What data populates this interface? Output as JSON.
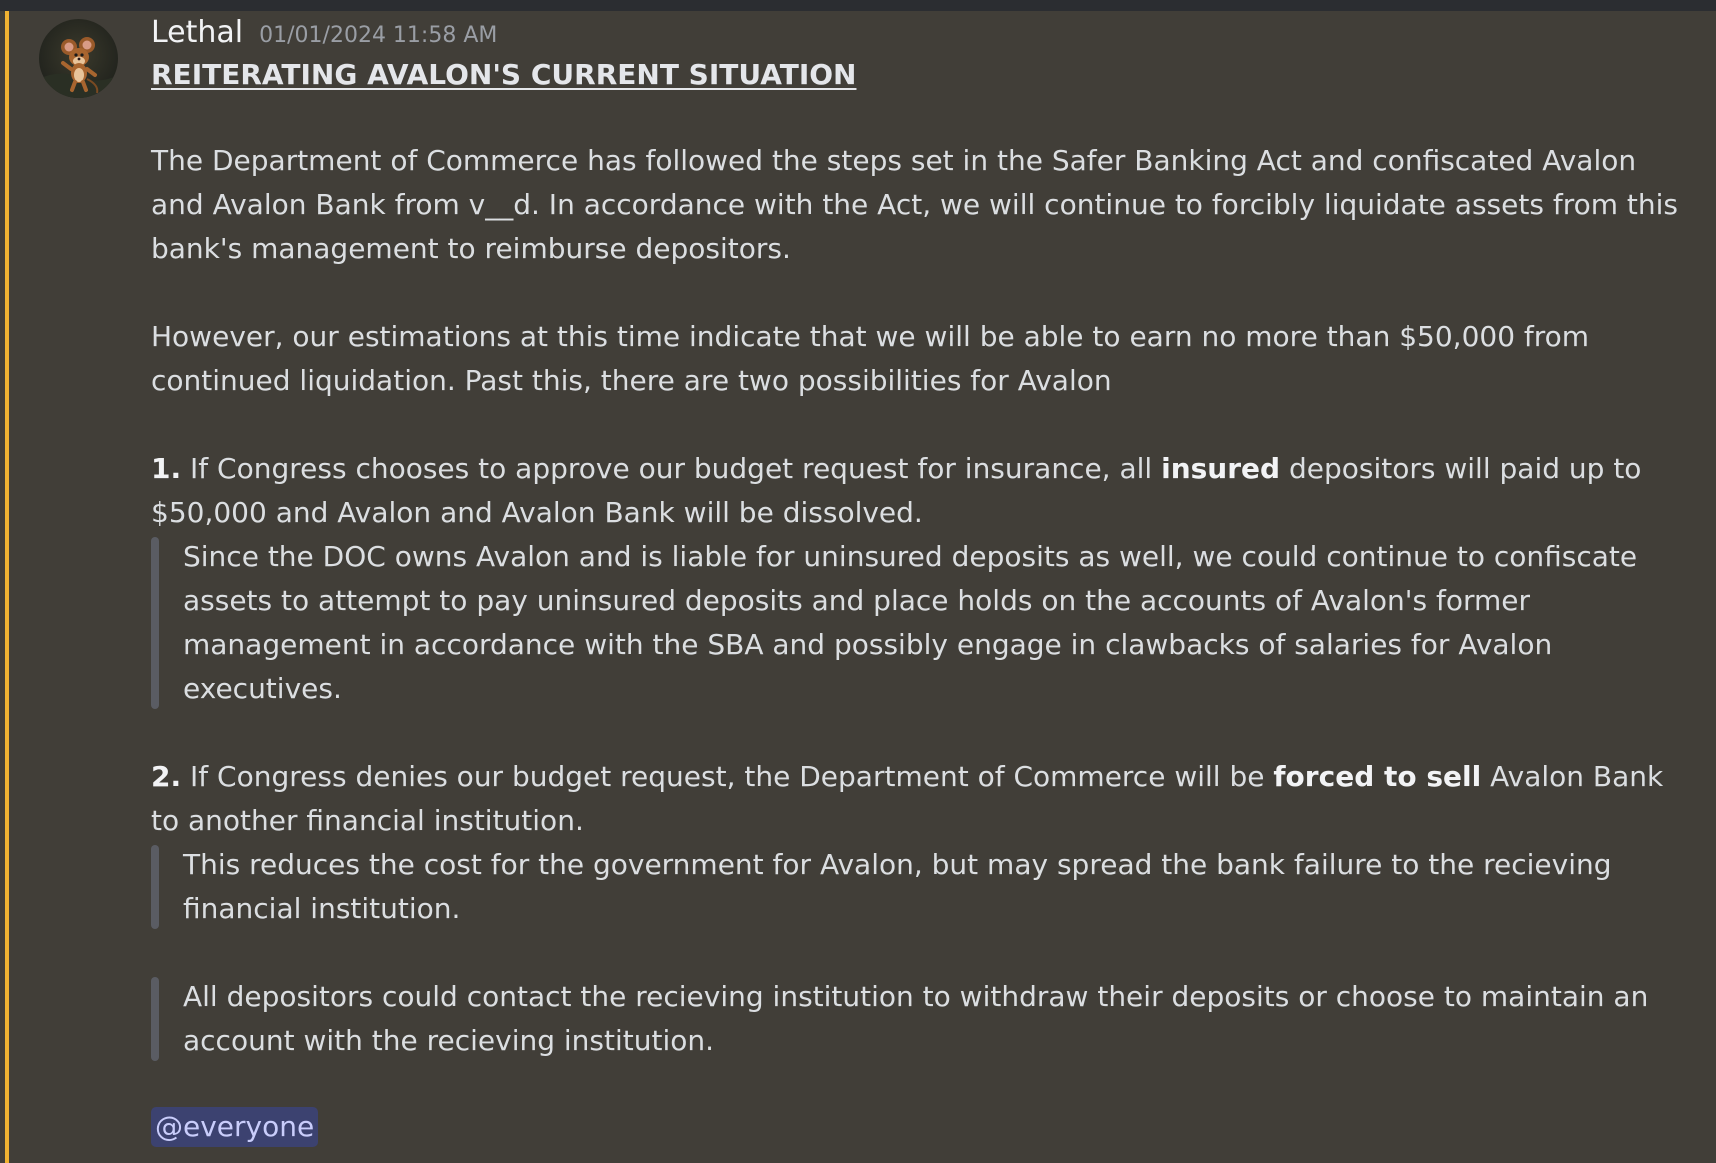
{
  "message": {
    "author": "Lethal",
    "timestamp": "01/01/2024 11:58 AM",
    "title": "REITERATING AVALON'S CURRENT SITUATION",
    "para1": "The Department of Commerce has followed the steps set in the Safer Banking Act and confiscated Avalon and Avalon Bank from v__d. In accordance with the Act, we will continue to forcibly liquidate assets from this bank's management to reimburse depositors.",
    "para2": "However, our estimations at this time indicate that we will be able to earn no more than $50,000 from continued liquidation. Past this, there are two possibilities for Avalon",
    "item1": {
      "number": "1.",
      "text_before": " If Congress chooses to approve our budget request for insurance, all ",
      "bold": "insured",
      "text_after": " depositors will paid up to $50,000 and Avalon and Avalon Bank will be dissolved.",
      "quote": "Since the DOC owns Avalon and is liable for uninsured deposits as well, we could continue to confiscate assets to attempt to pay uninsured deposits and place holds on the accounts of Avalon's former management in accordance with the SBA and possibly engage in clawbacks of salaries for Avalon executives."
    },
    "item2": {
      "number": "2.",
      "text_before": " If Congress denies our budget request, the Department of Commerce will be ",
      "bold": "forced to sell",
      "text_after": " Avalon Bank to another financial institution.",
      "quote1": "This reduces the cost for the government for Avalon, but may spread the bank failure to the recieving financial institution.",
      "quote2": "All depositors could contact the recieving institution to withdraw their deposits or choose to maintain an account with the recieving institution."
    },
    "mention": "@everyone"
  },
  "colors": {
    "message_bg": "#413e38",
    "mention_bar": "#f0b232",
    "mention_bg": "#3c4270",
    "mention_text": "#c9cdfb"
  },
  "icons": {
    "avatar": "cartoon-mouse-avatar"
  }
}
